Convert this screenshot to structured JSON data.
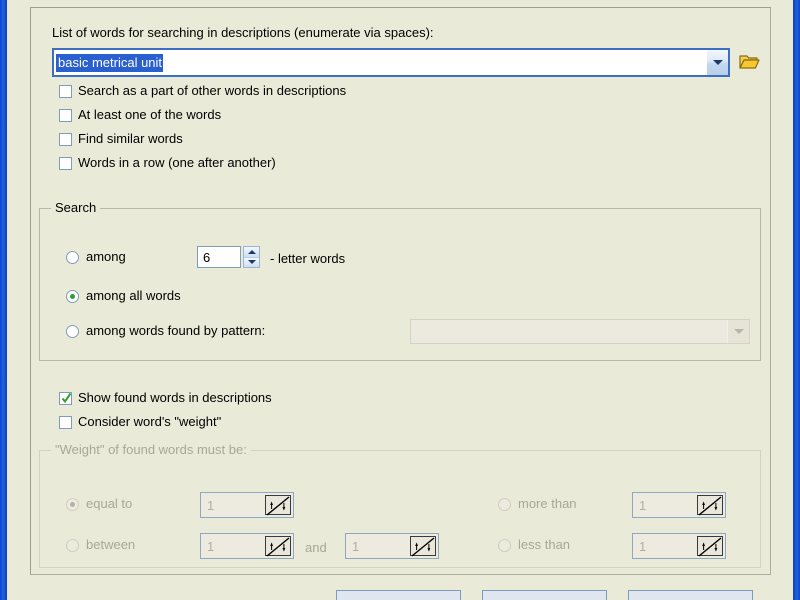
{
  "dialog": {
    "words_label": "List of words for searching in descriptions (enumerate via spaces):",
    "words_combo_value": "basic metrical unit",
    "browse_icon": "open-folder-icon",
    "dropdown_icon": "chevron-down-icon"
  },
  "options": [
    {
      "label": "Search as a part of other words in descriptions",
      "checked": false
    },
    {
      "label": "At least one of the words",
      "checked": false
    },
    {
      "label": "Find similar words",
      "checked": false
    },
    {
      "label": "Words in a row (one after another)",
      "checked": false
    }
  ],
  "search_group": {
    "legend": "Search",
    "among_n_letters": {
      "label": "among",
      "suffix": "- letter words",
      "value": "6",
      "selected": false
    },
    "among_all": {
      "label": "among all words",
      "selected": true
    },
    "among_pattern": {
      "label": "among words found by pattern:",
      "selected": false,
      "pattern_value": "",
      "disabled": true
    }
  },
  "display_options": [
    {
      "label": "Show found words in descriptions",
      "checked": true
    },
    {
      "label": "Consider word's \"weight\"",
      "checked": false
    }
  ],
  "weight_group": {
    "legend": "\"Weight\" of found words must be:",
    "disabled": true,
    "equal_to": {
      "label": "equal to",
      "value": "1",
      "selected": true
    },
    "between": {
      "label": "between",
      "value": "1",
      "selected": false
    },
    "and_label": "and",
    "between_max": {
      "value": "1"
    },
    "more_than": {
      "label": "more than",
      "value": "1",
      "selected": false
    },
    "less_than": {
      "label": "less than",
      "value": "1",
      "selected": false
    }
  },
  "colors": {
    "window_bg": "#eaead8",
    "selection_blue": "#2a5fd0",
    "check_green": "#2ea02e",
    "border_blue": "#7f9db9",
    "titlebar_blue": "#1e62e0"
  }
}
